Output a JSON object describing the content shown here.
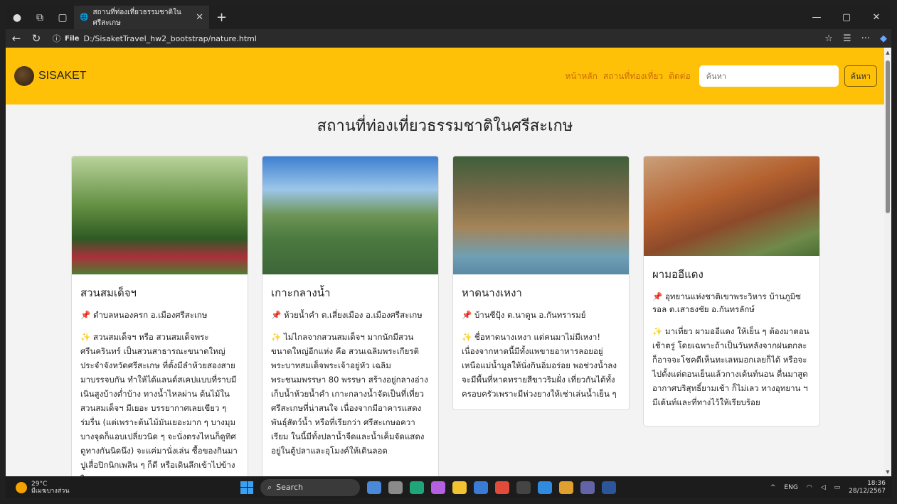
{
  "browser": {
    "tab_title": "สถานที่ท่องเที่ยวธรรมชาติในศรีสะเกษ",
    "file_label": "File",
    "url": "D:/SisaketTravel_hw2_bootstrap/nature.html"
  },
  "site": {
    "brand": "SISAKET",
    "nav": [
      "หน้าหลัก",
      "สถานที่ท่องเที่ยว",
      "ติดต่อ"
    ],
    "search_placeholder": "ค้นหา",
    "search_button": "ค้นหา",
    "page_title": "สถานที่ท่องเที่ยวธรรมชาติในศรีสะเกษ"
  },
  "cards": [
    {
      "title": "สวนสมเด็จฯ",
      "location": "ตำบลหนองครก อ.เมืองศรีสะเกษ",
      "text": "สวนสมเด็จฯ หรือ สวนสมเด็จพระศรีนครินทร์ เป็นสวนสาธารณะขนาดใหญ่ประจำจังหวัดศรีสะเกษ ที่ตั้งมีลำห้วยสองสายมาบรรจบกัน ทำให้ได้แลนด์สเคปแบบที่ราบมีเนินสูงบ้างต่ำบ้าง ทางน้ำไหลผ่าน ต้นไม้ในสวนสมเด็จฯ มีเยอะ บรรยากาศเลยเขียว ๆ ร่มรื่น (แต่เพราะต้นไม้มันเยอะมาก ๆ บางมุมบางจุดก็แอบเปลี่ยวนิด ๆ จะนั่งตรงไหนก็ดูทิศดูทางกันนิดนึง) จะแค่มานั่งเล่น ซื้อของกินมาปูเสื่อปิกนิกเพลิน ๆ ก็ดี หรือเดินลึกเข้าไปข้างในสุด ๆ"
    },
    {
      "title": "เกาะกลางน้ำ",
      "location": "ห้วยน้ำคำ ต.เสี่ยงเมือง อ.เมืองศรีสะเกษ",
      "text": "ไม่ไกลจากสวนสมเด็จฯ มากนักมีสวนขนาดใหญ่อีกแห่ง คือ สวนเฉลิมพระเกียรติพระบาทสมเด็จพระเจ้าอยู่หัว เฉลิมพระชนมพรรษา 80 พรรษา สร้างอยู่กลางอ่างเก็บน้ำห้วยน้ำคำ เกาะกลางน้ำจัดเป็นที่เที่ยวศรีสะเกษที่น่าสนใจ เนื่องจากมีอาคารแสดงพันธุ์สัตว์น้ำ หรือที่เรียกว่า ศรีสะเกษอควาเรียม ในนี้มีทั้งปลาน้ำจืดและน้ำเค็มจัดแสดงอยู่ในตู้ปลาและอุโมงค์ให้เดินลอด"
    },
    {
      "title": "หาดนางเหงา",
      "location": "บ้านซีปุ้ง ต.นาดูน อ.กันทรารมย์",
      "text": "ชื่อหาดนางเหงา แต่คนมาไม่มีเหงา! เนื่องจากหาดนี้มีทั้งแพขายอาหารลอยอยู่เหนือแม่น้ำมูลให้นั่งกินอิ่มอร่อย พอช่วงน้ำลงจะมีพื้นที่หาดทรายสีขาวริมฝั่ง เที่ยวกันได้ทั้งครอบครัวเพราะมีห่วงยางให้เช่าเล่นน้ำเย็น ๆ"
    },
    {
      "title": "ผามออีแดง",
      "location": "อุทยานแห่งชาติเขาพระวิหาร บ้านภูมิซรอล ต.เสาธงชัย อ.กันทรลักษ์",
      "text": "มาเที่ยว ผามออีแดง ให้เย็น ๆ ต้องมาตอนเช้าตรู่ โดยเฉพาะถ้าเป็นวันหลังจากฝนตกละก็อาจจะโชคดีเห็นทะเลหมอกเลยก็ได้ หรือจะไปตั้งแต่ตอนเย็นแล้วกางเต้นท์นอน ตื่นมาสูดอากาศบริสุทธิ์ยามเช้า ก็ไม่เลว ทางอุทยาน ฯ มีเต้นท์และที่ทางไว้ให้เรียบร้อย"
    }
  ],
  "taskbar": {
    "temp": "29°C",
    "weather": "มีเมฆบางส่วน",
    "search": "Search",
    "lang": "ENG",
    "time": "18:36",
    "date": "28/12/2567"
  }
}
